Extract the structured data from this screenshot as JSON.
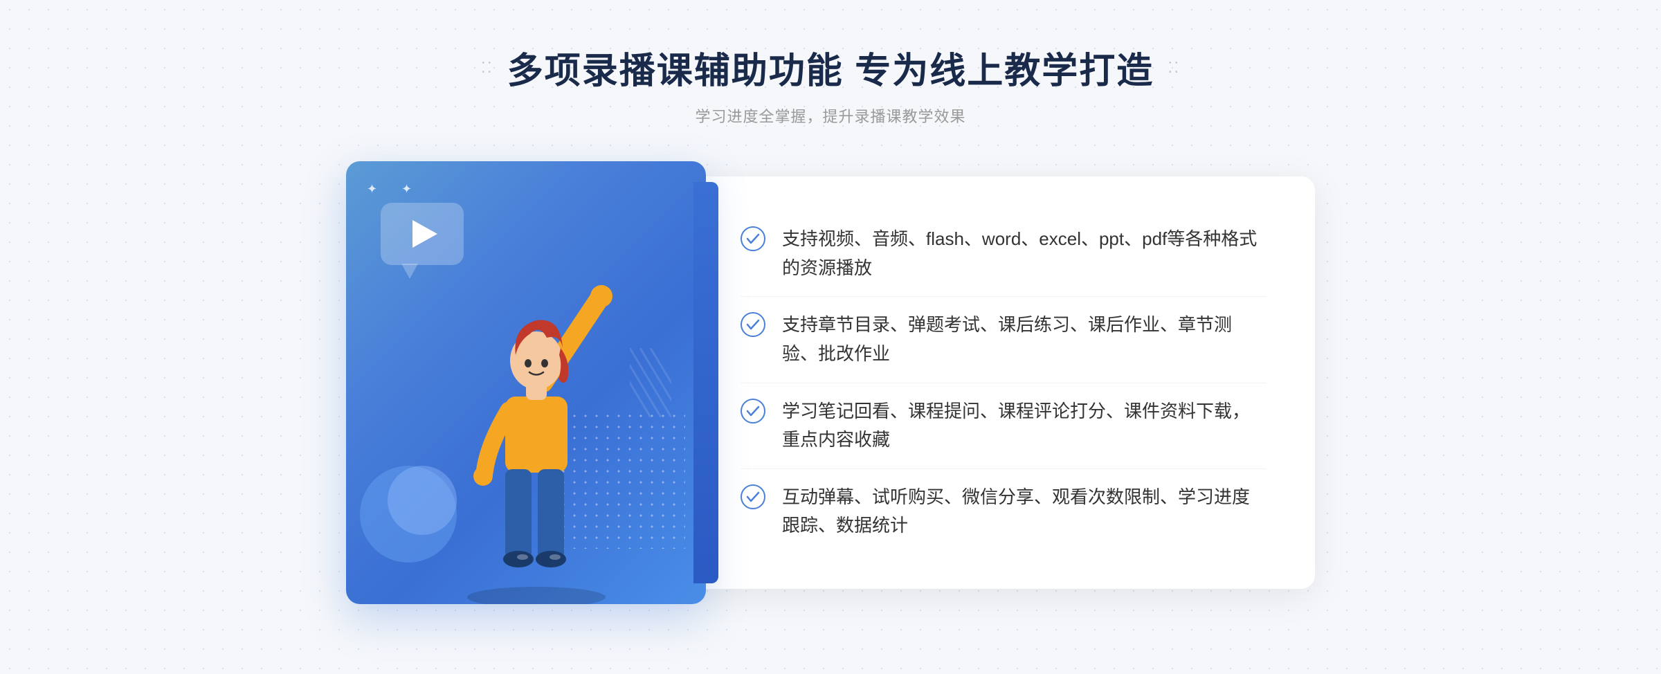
{
  "header": {
    "title": "多项录播课辅助功能 专为线上教学打造",
    "subtitle": "学习进度全掌握，提升录播课教学效果",
    "decorative_left": "⁞⁞",
    "decorative_right": "⁞⁞"
  },
  "features": [
    {
      "id": 1,
      "text": "支持视频、音频、flash、word、excel、ppt、pdf等各种格式的资源播放"
    },
    {
      "id": 2,
      "text": "支持章节目录、弹题考试、课后练习、课后作业、章节测验、批改作业"
    },
    {
      "id": 3,
      "text": "学习笔记回看、课程提问、课程评论打分、课件资料下载，重点内容收藏"
    },
    {
      "id": 4,
      "text": "互动弹幕、试听购买、微信分享、观看次数限制、学习进度跟踪、数据统计"
    }
  ],
  "colors": {
    "primary_blue": "#4a80d9",
    "dark_blue": "#1a2a4a",
    "text_gray": "#333333",
    "subtitle_gray": "#999999",
    "check_color": "#4a80d9"
  },
  "icons": {
    "check": "check-circle",
    "play": "play-triangle",
    "arrow_left": "double-chevron-left",
    "arrow_right": "double-chevron-right"
  }
}
